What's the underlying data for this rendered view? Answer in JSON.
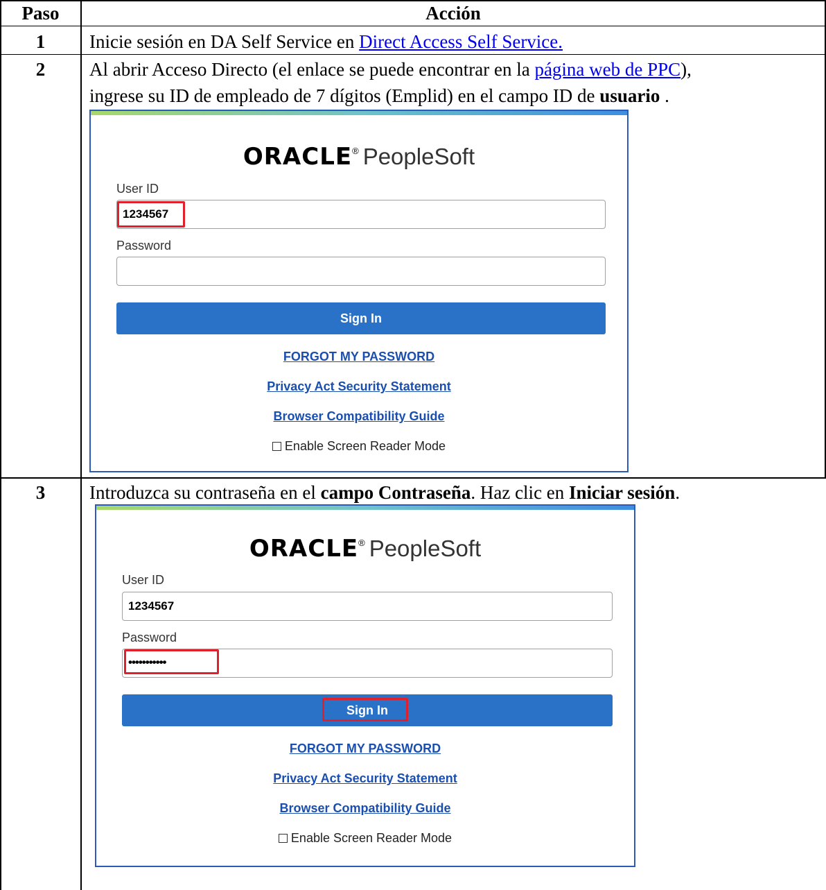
{
  "header": {
    "paso": "Paso",
    "accion": "Acción"
  },
  "row1": {
    "num": "1",
    "text_before": "Inicie sesión en DA  Self Service en ",
    "link": "Direct Access Self Service."
  },
  "row2": {
    "num": "2",
    "line1_before": "Al abrir Acceso Directo (el enlace se puede encontrar en la ",
    "line1_link": "página web de PPC",
    "line1_after": "),",
    "line2_before": "ingrese su ID de empleado de 7 dígitos (Emplid) en el campo ID de ",
    "line2_bold": "usuario",
    "line2_after": " ."
  },
  "row3": {
    "num": "3",
    "t1": "Introduzca su contraseña en el  ",
    "t1_bold": "campo Contraseña",
    "t2": ".  Haz clic en ",
    "t2_bold": "Iniciar sesión",
    "t3": "."
  },
  "login": {
    "brand": "ORACLE",
    "brand_mark": "®",
    "product": "PeopleSoft",
    "user_id_label": "User ID",
    "user_id_value": "1234567",
    "password_label": "Password",
    "password_masked": "•••••••••••",
    "sign_in": "Sign In",
    "forgot": "FORGOT MY PASSWORD",
    "privacy": "Privacy Act Security Statement",
    "browser": "Browser Compatibility Guide",
    "screen_reader": "Enable Screen Reader Mode"
  },
  "colors": {
    "highlight": "#e0202a",
    "button": "#2a72c8",
    "link": "#1a4fb0"
  }
}
